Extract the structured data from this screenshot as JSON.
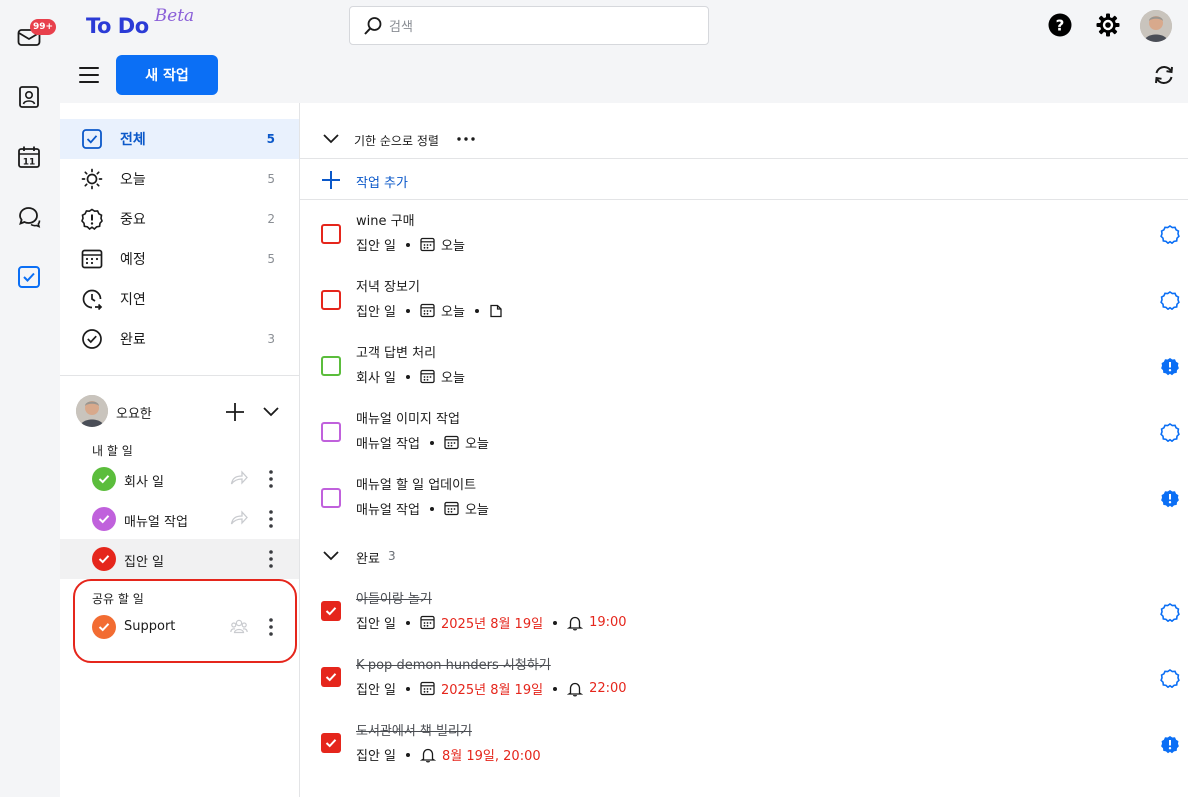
{
  "app": {
    "name": "To Do",
    "tag": "Beta",
    "mail_badge": "99+"
  },
  "search": {
    "placeholder": "검색"
  },
  "toolbar": {
    "new_task": "새 작업"
  },
  "nav": [
    {
      "id": "all",
      "label": "전체",
      "count": "5",
      "icon": "check-square-icon",
      "active": true
    },
    {
      "id": "today",
      "label": "오늘",
      "count": "5",
      "icon": "sun-icon"
    },
    {
      "id": "important",
      "label": "중요",
      "count": "2",
      "icon": "exclamation-circle-icon"
    },
    {
      "id": "planned",
      "label": "예정",
      "count": "5",
      "icon": "calendar-icon"
    },
    {
      "id": "overdue",
      "label": "지연",
      "count": "",
      "icon": "clock-arrow-icon"
    },
    {
      "id": "completed",
      "label": "완료",
      "count": "3",
      "icon": "check-circle-icon"
    }
  ],
  "account": {
    "name": "오요한"
  },
  "my_lists": {
    "label": "내 할 일",
    "items": [
      {
        "label": "회사 일",
        "color": "#5bbd3c"
      },
      {
        "label": "매뉴얼 작업",
        "color": "#c061dc"
      },
      {
        "label": "집안 일",
        "color": "#e5261c",
        "active": true
      }
    ]
  },
  "shared_lists": {
    "label": "공유 할 일",
    "items": [
      {
        "label": "Support",
        "color": "#f26c32"
      }
    ]
  },
  "main": {
    "sort_label": "기한 순으로 정렬",
    "add_task": "작업 추가",
    "done_label": "완료",
    "done_count": "3"
  },
  "tasks": [
    {
      "title": "wine 구매",
      "list": "집안 일",
      "due": "오늘",
      "color": "#e5261c",
      "has_note": false,
      "star": "outline"
    },
    {
      "title": "저녁 장보기",
      "list": "집안 일",
      "due": "오늘",
      "color": "#e5261c",
      "has_note": true,
      "star": "outline"
    },
    {
      "title": "고객 답변 처리",
      "list": "회사 일",
      "due": "오늘",
      "color": "#5bbd3c",
      "has_note": false,
      "star": "filled"
    },
    {
      "title": "매뉴얼 이미지 작업",
      "list": "매뉴얼 작업",
      "due": "오늘",
      "color": "#c061dc",
      "has_note": false,
      "star": "outline"
    },
    {
      "title": "매뉴얼 할 일 업데이트",
      "list": "매뉴얼 작업",
      "due": "오늘",
      "color": "#c061dc",
      "has_note": false,
      "star": "filled"
    }
  ],
  "done_tasks": [
    {
      "title": "아들이랑 놀기",
      "list": "집안 일",
      "due": "2025년 8월 19일",
      "reminder": "19:00",
      "star": "outline"
    },
    {
      "title": "K-pop demon hunders 시청하기",
      "list": "집안 일",
      "due": "2025년 8월 19일",
      "reminder": "22:00",
      "star": "outline"
    },
    {
      "title": "도서관에서 책 빌리기",
      "list": "집안 일",
      "due": "",
      "reminder": "8월 19일, 20:00",
      "star": "filled"
    }
  ]
}
